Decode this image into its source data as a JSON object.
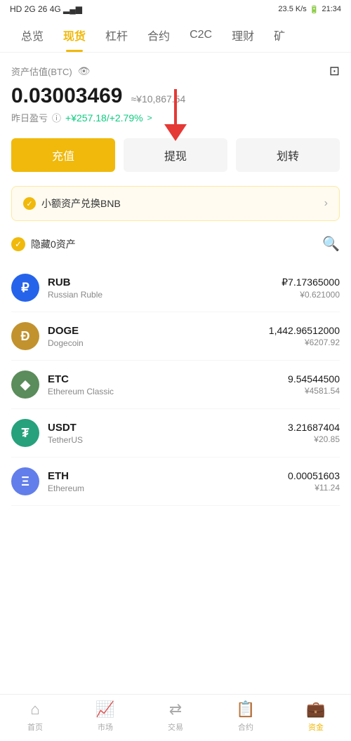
{
  "statusBar": {
    "left": "HD 2G 26 4G",
    "speed": "23.5 K/s",
    "time": "21:34"
  },
  "topNav": {
    "items": [
      {
        "label": "总览",
        "active": false
      },
      {
        "label": "现货",
        "active": true
      },
      {
        "label": "杠杆",
        "active": false
      },
      {
        "label": "合约",
        "active": false
      },
      {
        "label": "C2C",
        "active": false
      },
      {
        "label": "理财",
        "active": false
      },
      {
        "label": "矿",
        "active": false
      }
    ]
  },
  "asset": {
    "label": "资产估值(BTC)",
    "btcAmount": "0.03003469",
    "cnyApprox": "≈¥10,867.54",
    "profitLabel": "昨日盈亏",
    "profitValue": "+¥257.18/+2.79%",
    "profitArrow": ">"
  },
  "buttons": {
    "deposit": "充值",
    "withdraw": "提现",
    "transfer": "划转"
  },
  "bnbExchange": {
    "label": "小额资产兑换BNB",
    "arrow": "›"
  },
  "filterRow": {
    "hideLabel": "隐藏0资产"
  },
  "assets": [
    {
      "symbol": "RUB",
      "fullname": "Russian Ruble",
      "iconText": "₽",
      "iconClass": "coin-rub",
      "amount": "₽7.17365000",
      "cny": "¥0.621000"
    },
    {
      "symbol": "DOGE",
      "fullname": "Dogecoin",
      "iconText": "Ð",
      "iconClass": "coin-doge",
      "amount": "1,442.96512000",
      "cny": "¥6207.92"
    },
    {
      "symbol": "ETC",
      "fullname": "Ethereum Classic",
      "iconText": "◆",
      "iconClass": "coin-etc",
      "amount": "9.54544500",
      "cny": "¥4581.54"
    },
    {
      "symbol": "USDT",
      "fullname": "TetherUS",
      "iconText": "₮",
      "iconClass": "coin-usdt",
      "amount": "3.21687404",
      "cny": "¥20.85"
    },
    {
      "symbol": "ETH",
      "fullname": "Ethereum",
      "iconText": "Ξ",
      "iconClass": "coin-eth",
      "amount": "0.00051603",
      "cny": "¥11.24"
    }
  ],
  "bottomNav": {
    "items": [
      {
        "label": "首页",
        "icon": "⌂",
        "active": false
      },
      {
        "label": "市场",
        "icon": "📊",
        "active": false
      },
      {
        "label": "交易",
        "icon": "🔄",
        "active": false
      },
      {
        "label": "合约",
        "icon": "📋",
        "active": false
      },
      {
        "label": "资金",
        "icon": "💼",
        "active": true
      }
    ]
  }
}
